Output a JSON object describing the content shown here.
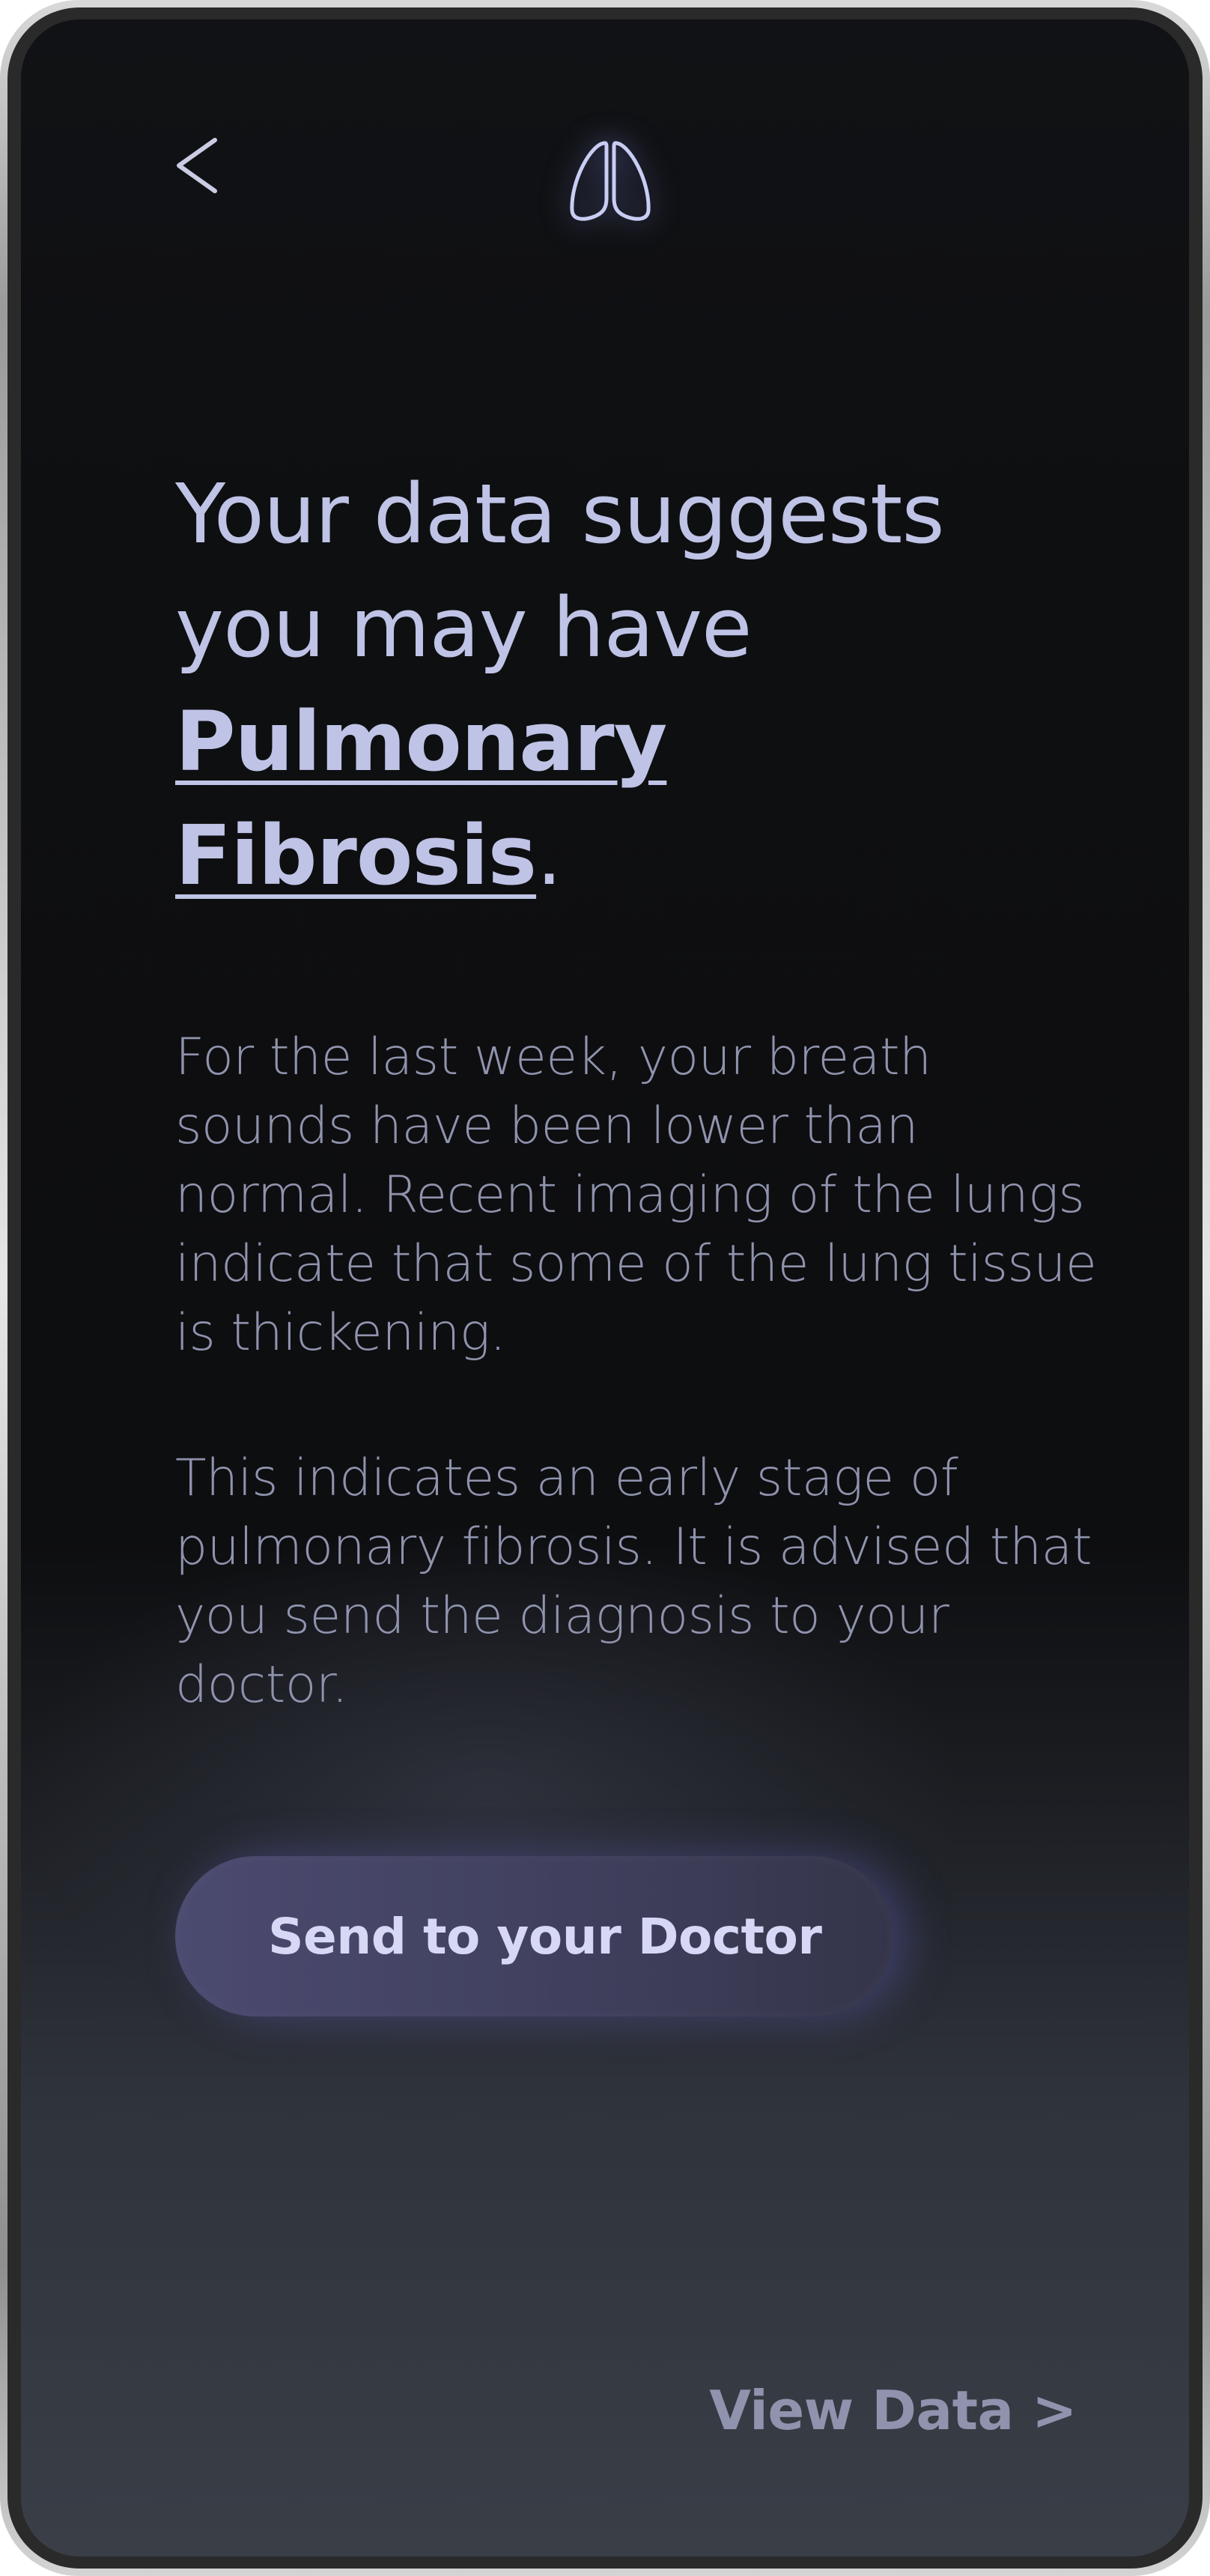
{
  "header": {
    "back_icon": "chevron-left-icon",
    "logo_icon": "lungs-icon"
  },
  "headline": {
    "prefix": "Your data suggests you may have ",
    "diagnosis": "Pulmonary Fibrosis",
    "suffix": "."
  },
  "body": {
    "paragraph_1": "For the last week, your breath sounds have been lower than normal. Recent imaging of the lungs indicate that some of the lung tissue is thickening.",
    "paragraph_2": "This indicates an early stage of pulmonary fibrosis. It is advised that you send the diagnosis to your doctor."
  },
  "actions": {
    "send_label": "Send to your Doctor",
    "view_data_label": "View Data >"
  },
  "colors": {
    "background": "#0e0f11",
    "headline": "#bfc3e6",
    "body_text": "#8f93ad",
    "button": "#4b4a70",
    "button_text": "#d6d8f5",
    "glow": "#8c96ff"
  }
}
